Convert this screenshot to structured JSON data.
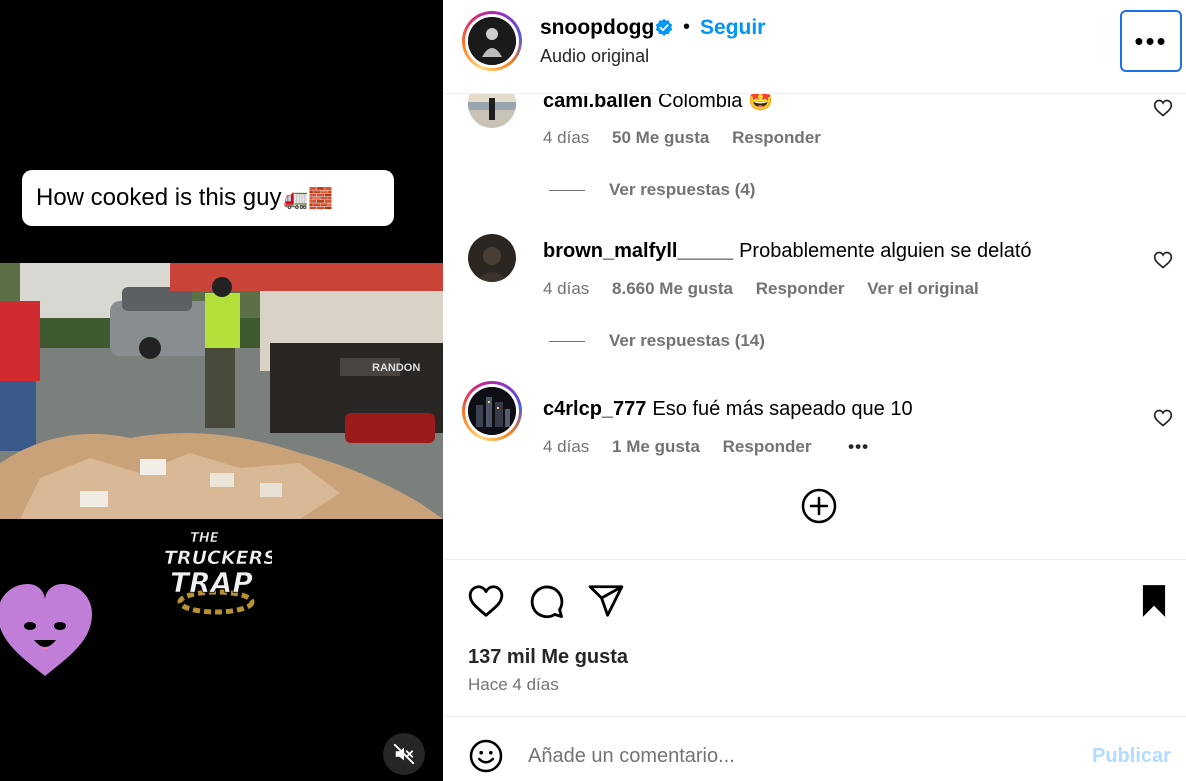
{
  "video": {
    "caption": "How cooked is this guy",
    "caption_emoji": "🚛🧱",
    "truck_badge": "RANDON",
    "logo_top": "THE",
    "logo_mid": "TRUCKERS",
    "logo_bottom": "TRAP",
    "mute_icon": "muted-speaker-icon"
  },
  "header": {
    "username": "snoopdogg",
    "verified": true,
    "separator": "•",
    "follow_label": "Seguir",
    "audio_label": "Audio original",
    "more_label": "•••"
  },
  "comments": [
    {
      "username": "cami.ballen",
      "text": "Colombia 🤩",
      "time": "4 días",
      "likes": "50 Me gusta",
      "reply": "Responder",
      "view_replies": "Ver respuestas (4)"
    },
    {
      "username": "brown_malfyll_____",
      "text": "Probablemente alguien se delató",
      "time": "4 días",
      "likes": "8.660 Me gusta",
      "reply": "Responder",
      "see_original": "Ver el original",
      "view_replies": "Ver respuestas (14)"
    },
    {
      "username": "c4rlcp_777",
      "text": "Eso fué más sapeado que 10",
      "time": "4 días",
      "likes": "1 Me gusta",
      "reply": "Responder",
      "more": "•••"
    }
  ],
  "actions": {
    "likes_count": "137 mil Me gusta",
    "time_ago": "Hace 4 días"
  },
  "composer": {
    "placeholder": "Añade un comentario...",
    "publish_label": "Publicar"
  },
  "colors": {
    "accent_blue": "#0095f6",
    "publish_disabled": "#b3dbff",
    "muted_text": "#737373",
    "focus_outline": "#1a73e8"
  }
}
